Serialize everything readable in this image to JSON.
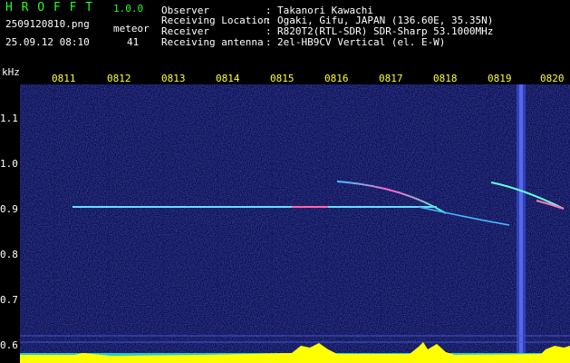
{
  "header": {
    "app_name": "H R O F F T",
    "version": "1.0.0",
    "filename": "2509120810.png",
    "meteor_label": "meteor",
    "timestamp": "25.09.12 08:10",
    "meteor_count": "41",
    "info": [
      {
        "key": "Observer",
        "sep": ":",
        "value": "Takanori Kawachi"
      },
      {
        "key": "Receiving Location",
        "sep": ":",
        "value": "Ogaki, Gifu, JAPAN (136.60E, 35.35N)"
      },
      {
        "key": "Receiver",
        "sep": ":",
        "value": "R820T2(RTL-SDR) SDR-Sharp 53.1000MHz"
      },
      {
        "key": "Receiving antenna",
        "sep": ":",
        "value": "2el-HB9CV Vertical (el. E-W)"
      }
    ]
  },
  "axes": {
    "y_unit": "kHz",
    "y_ticks": [
      "1.1",
      "1.0",
      "0.9",
      "0.8",
      "0.7",
      "0.6"
    ],
    "x_ticks": [
      "0811",
      "0812",
      "0813",
      "0814",
      "0815",
      "0816",
      "0817",
      "0818",
      "0819",
      "0820"
    ]
  },
  "colors": {
    "text_green": "#22ff22",
    "text_white": "#ffffff",
    "tick_yellow": "#ffff33",
    "background": "#000000",
    "spectrum_bg": "#0a0a4a"
  }
}
